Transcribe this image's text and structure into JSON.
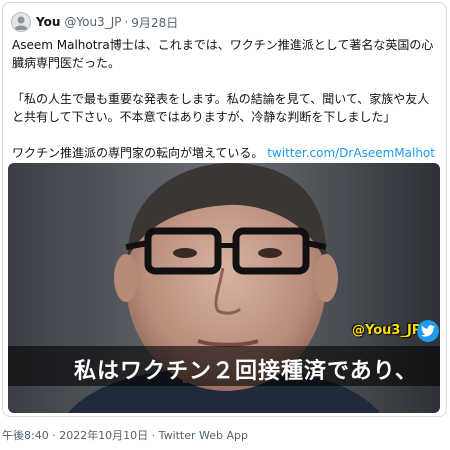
{
  "tweet": {
    "display_name": "You",
    "handle": "@You3_JP",
    "separator": "·",
    "date": "9月28日",
    "text_line1": "Aseem Malhotra博士は、これまでは、ワクチン推進派として著名な英国の心臓病専門医だった。",
    "text_quote": "「私の人生で最も重要な発表をします。私の結論を見て、聞いて、家族や友人と共有して下さい。不本意ではありますが、冷静な判断を下しました」",
    "text_last": "ワクチン推進派の専門家の転向が増えている。 ",
    "link": "twitter.com/DrAseemMalhotr...",
    "avatar_icon": "user-avatar-icon"
  },
  "media": {
    "watermark": "@You3_JP",
    "badge_icon": "twitter-bird-icon",
    "caption": "私はワクチン２回接種済であり、"
  },
  "footer": {
    "meta": "午後8:40 · 2022年10月10日 · Twitter Web App"
  },
  "colors": {
    "accent": "#1d9bf0",
    "text": "#0f1419",
    "muted": "#536471",
    "watermark": "#ffdf00"
  }
}
